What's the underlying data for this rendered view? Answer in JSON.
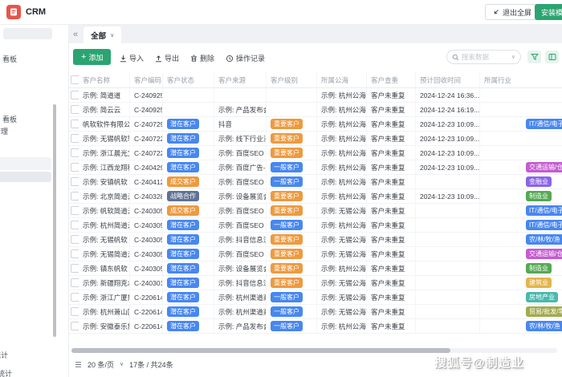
{
  "app": {
    "title": "CRM",
    "brand_color": "#e85449",
    "accent_green": "#2ba471"
  },
  "header": {
    "exit_fullscreen": "退出全屏",
    "install_template": "安装模板"
  },
  "tabbar": {
    "collapse": "«",
    "active_tab": "全部",
    "chevron": "∨"
  },
  "sidebar": {
    "fragments": [
      {
        "text": "看板"
      },
      {
        "text": "看板"
      },
      {
        "text": "管理"
      },
      {
        "text": "统计"
      },
      {
        "text": "统计"
      }
    ]
  },
  "toolbar": {
    "add": "添加",
    "import": "导入",
    "export": "导出",
    "delete": "删除",
    "log": "操作记录",
    "search_placeholder": "搜索数据"
  },
  "table": {
    "columns": [
      {
        "key": "name",
        "label": "客户名称"
      },
      {
        "key": "code",
        "label": "客户编码"
      },
      {
        "key": "status",
        "label": "客户状态"
      },
      {
        "key": "source",
        "label": "客户来源"
      },
      {
        "key": "level",
        "label": "客户级别"
      },
      {
        "key": "pool",
        "label": "所属公海"
      },
      {
        "key": "dedup",
        "label": "客户查重"
      },
      {
        "key": "time",
        "label": "预计回收时间"
      },
      {
        "key": "industry",
        "label": "所属行业"
      }
    ],
    "rows": [
      {
        "name": "示例: 简道道",
        "code": "C-240925...",
        "status": null,
        "source": "",
        "level": null,
        "pool": "示例: 杭州公海池",
        "dedup": "客户未重复",
        "time": "2024-12-24 16:36...",
        "industry": null
      },
      {
        "name": "示例: 简云云",
        "code": "C-240925...",
        "status": null,
        "source": "示例: 产品发布会...",
        "level": null,
        "pool": "示例: 杭州公海池",
        "dedup": "客户未重复",
        "time": "2024-12-24 16:19...",
        "industry": null
      },
      {
        "name": "帆软软件有限公司",
        "code": "C-240729...",
        "status": {
          "text": "潜在客户",
          "color": "#4787f0"
        },
        "source": "抖音",
        "level": {
          "text": "重要客户",
          "color": "#ee9a3e"
        },
        "pool": "示例: 杭州公海池",
        "dedup": "客户未重复",
        "time": "2024-12-23 10:09...",
        "industry": {
          "text": "IT/通信/电子",
          "color": "#4787f0"
        }
      },
      {
        "name": "示例: 无锡帆软软件",
        "code": "C-240722...",
        "status": {
          "text": "潜在客户",
          "color": "#4787f0"
        },
        "source": "示例: 线下行业沙龙",
        "level": {
          "text": "重要客户",
          "color": "#ee9a3e"
        },
        "pool": "示例: 杭州公海池",
        "dedup": "客户未重复",
        "time": "2024-12-23 10:09...",
        "industry": null
      },
      {
        "name": "示例: 浙江晨光文...",
        "code": "C-240722...",
        "status": {
          "text": "潜在客户",
          "color": "#4787f0"
        },
        "source": "示例: 百度SEO",
        "level": {
          "text": "重要客户",
          "color": "#ee9a3e"
        },
        "pool": "示例: 杭州公海池",
        "dedup": "客户未重复",
        "time": "2024-12-23 10:09...",
        "industry": null
      },
      {
        "name": "示例: 江西龙翔科...",
        "code": "C-240429...",
        "status": {
          "text": "潜在客户",
          "color": "#4787f0"
        },
        "source": "示例: 百度广告-SEM",
        "level": {
          "text": "一般客户",
          "color": "#4787f0"
        },
        "pool": "示例: 杭州公海池",
        "dedup": "客户未重复",
        "time": "2024-12-23 10:09...",
        "industry": {
          "text": "交通运输/仓储",
          "color": "#c55bd2"
        }
      },
      {
        "name": "示例: 安镇帆软",
        "code": "C-240412...",
        "status": {
          "text": "成交客户",
          "color": "#ee9a3e"
        },
        "source": "示例: 百度SEO",
        "level": {
          "text": "一般客户",
          "color": "#4787f0"
        },
        "pool": "示例: 杭州公海池",
        "dedup": "客户未重复",
        "time": "",
        "industry": {
          "text": "金融业",
          "color": "#8a64e8"
        }
      },
      {
        "name": "示例: 北京简道云...",
        "code": "C-240328...",
        "status": {
          "text": "战略合作",
          "color": "#5f7292"
        },
        "source": "示例: 设备展览会...",
        "level": {
          "text": "重要客户",
          "color": "#ee9a3e"
        },
        "pool": "示例: 杭州公海池",
        "dedup": "客户未重复",
        "time": "2024-12-23 10:09...",
        "industry": {
          "text": "制造业",
          "color": "#55a854"
        }
      },
      {
        "name": "示例: 帆软简道云",
        "code": "C-240305...",
        "status": {
          "text": "成交客户",
          "color": "#ee9a3e"
        },
        "source": "示例: 百度SEO",
        "level": {
          "text": "重要客户",
          "color": "#ee9a3e"
        },
        "pool": "示例: 无锡公海池",
        "dedup": "客户未重复",
        "time": "",
        "industry": {
          "text": "IT/通信/电子",
          "color": "#4787f0"
        }
      },
      {
        "name": "示例: 杭州简道云",
        "code": "C-240305...",
        "status": {
          "text": "潜在客户",
          "color": "#4787f0"
        },
        "source": "示例: 百度SEO",
        "level": {
          "text": "一般客户",
          "color": "#4787f0"
        },
        "pool": "示例: 杭州公海池",
        "dedup": "客户未重复",
        "time": "",
        "industry": {
          "text": "IT/通信/电子",
          "color": "#4787f0"
        }
      },
      {
        "name": "示例: 无锡帆软",
        "code": "C-240305...",
        "status": {
          "text": "潜在客户",
          "color": "#4787f0"
        },
        "source": "示例: 抖音信息流",
        "level": {
          "text": "重要客户",
          "color": "#ee9a3e"
        },
        "pool": "示例: 无锡公海池",
        "dedup": "客户未重复",
        "time": "",
        "industry": {
          "text": "农/林/牧/渔",
          "color": "#4787f0"
        }
      },
      {
        "name": "示例: 无锡简道云",
        "code": "C-240305...",
        "status": {
          "text": "潜在客户",
          "color": "#4787f0"
        },
        "source": "示例: 百度SEO",
        "level": {
          "text": "重要客户",
          "color": "#ee9a3e"
        },
        "pool": "示例: 无锡公海池",
        "dedup": "客户未重复",
        "time": "",
        "industry": {
          "text": "交通运输/仓储",
          "color": "#c55bd2"
        }
      },
      {
        "name": "示例: 镇东帆软",
        "code": "C-240305...",
        "status": {
          "text": "潜在客户",
          "color": "#4787f0"
        },
        "source": "示例: 设备展览会...",
        "level": {
          "text": "重要客户",
          "color": "#ee9a3e"
        },
        "pool": "示例: 杭州公海池",
        "dedup": "客户未重复",
        "time": "",
        "industry": {
          "text": "制造业",
          "color": "#55a854"
        }
      },
      {
        "name": "示例: 新疆翔克水...",
        "code": "C-240301...",
        "status": {
          "text": "潜在客户",
          "color": "#4787f0"
        },
        "source": "示例: 抖音信息流",
        "level": {
          "text": "重要客户",
          "color": "#ee9a3e"
        },
        "pool": "示例: 无锡公海池",
        "dedup": "客户未重复",
        "time": "",
        "industry": {
          "text": "建筑业",
          "color": "#e3b44a"
        }
      },
      {
        "name": "示例: 浙江广厦集团",
        "code": "C-220614...",
        "status": {
          "text": "潜在客户",
          "color": "#4787f0"
        },
        "source": "示例: 杭州渠道商...",
        "level": {
          "text": "一般客户",
          "color": "#4787f0"
        },
        "pool": "示例: 无锡公海池",
        "dedup": "客户未重复",
        "time": "",
        "industry": {
          "text": "房地产业",
          "color": "#4ab8ae"
        }
      },
      {
        "name": "示例: 杭州萧山国...",
        "code": "C-220614...",
        "status": {
          "text": "潜在客户",
          "color": "#4787f0"
        },
        "source": "示例: 杭州渠道商...",
        "level": {
          "text": "一般客户",
          "color": "#4787f0"
        },
        "pool": "示例: 无锡公海池",
        "dedup": "客户未重复",
        "time": "",
        "industry": {
          "text": "贸易/批发/零售",
          "color": "#a3aa4e"
        }
      },
      {
        "name": "示例: 安徽泰乐集团",
        "code": "C-220614...",
        "status": {
          "text": "潜在客户",
          "color": "#4787f0"
        },
        "source": "示例: 产品发布会...",
        "level": {
          "text": "一般客户",
          "color": "#4787f0"
        },
        "pool": "示例: 杭州公海池",
        "dedup": "客户未重复",
        "time": "",
        "industry": {
          "text": "农/林/牧/渔",
          "color": "#4787f0"
        }
      }
    ]
  },
  "pagination": {
    "page_size": "20 条/页",
    "chevron": "∨",
    "total": "17条 / 共24条"
  },
  "watermark": "搜狐号@制造业"
}
